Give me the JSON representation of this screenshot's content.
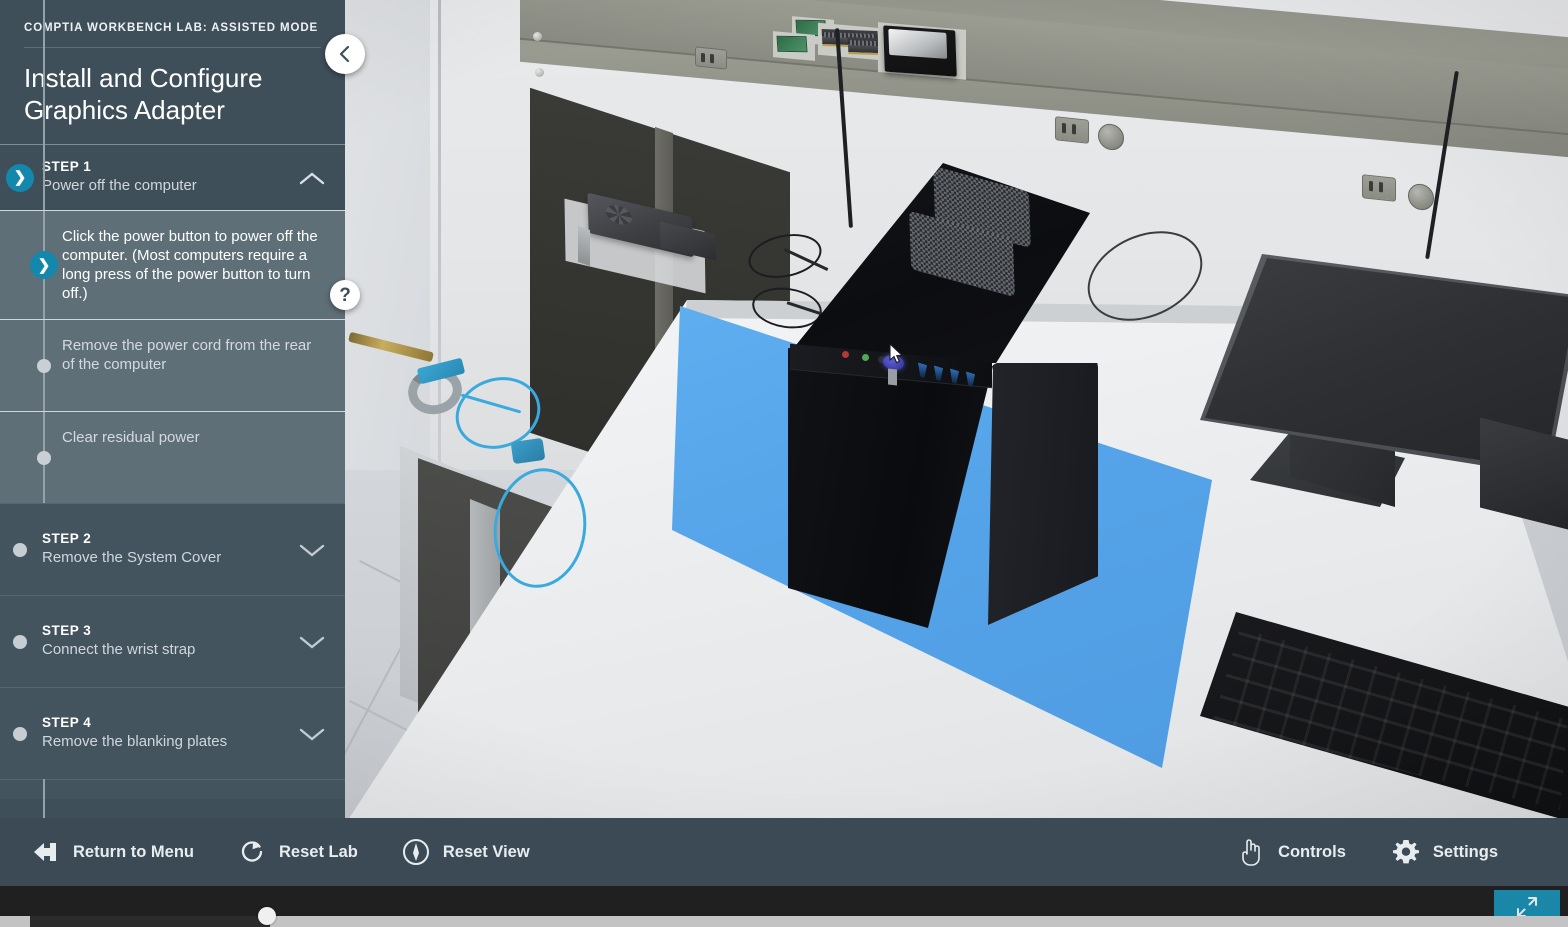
{
  "sidebar": {
    "kicker": "COMPTIA WORKBENCH LAB: ASSISTED MODE",
    "title": "Install and Configure Graphics Adapter",
    "back_icon": "chevron-left-icon",
    "help_icon": "question-mark-icon",
    "steps": [
      {
        "label": "STEP 1",
        "desc": "Power off the computer",
        "state": "active",
        "chevron": "chevron-up-icon",
        "substeps": [
          {
            "text": "Click the power button to power off the computer. (Most computers require a long press of the power button to turn off.)",
            "state": "current"
          },
          {
            "text": "Remove the power cord from the rear of the computer",
            "state": "pending"
          },
          {
            "text": "Clear residual power",
            "state": "pending"
          }
        ]
      },
      {
        "label": "STEP 2",
        "desc": "Remove the System Cover",
        "state": "idle",
        "chevron": "chevron-down-icon",
        "substeps": []
      },
      {
        "label": "STEP 3",
        "desc": "Connect the wrist strap",
        "state": "idle",
        "chevron": "chevron-down-icon",
        "substeps": []
      },
      {
        "label": "STEP 4",
        "desc": "Remove the blanking plates",
        "state": "idle",
        "chevron": "chevron-down-icon",
        "substeps": []
      }
    ]
  },
  "toolbar": {
    "left": [
      {
        "label": "Return to Menu",
        "icon": "back-arrow-icon"
      },
      {
        "label": "Reset Lab",
        "icon": "refresh-circle-icon"
      },
      {
        "label": "Reset View",
        "icon": "compass-circle-icon"
      }
    ],
    "right": [
      {
        "label": "Controls",
        "icon": "hand-pointer-icon"
      },
      {
        "label": "Settings",
        "icon": "gear-icon"
      }
    ]
  },
  "browser_chrome": {
    "fullscreen_icon": "expand-arrows-icon",
    "scrollbar": "horizontal-scrollbar"
  },
  "scene": {
    "description": "3D workbench lab with desk, PC tower, monitor, keyboard, ESD mat and wrist strap",
    "objects": [
      "pc-tower",
      "monitor",
      "keyboard",
      "graphics-adapter",
      "esd-mat",
      "esd-wrist-strap",
      "hard-drive",
      "ram-modules",
      "power-cable",
      "screwdriver"
    ],
    "cursor_icon": "mouse-cursor"
  },
  "colors": {
    "sidebar_bg": "#3e4f5a",
    "substep_bg": "#5f6f78",
    "accent": "#1487ac",
    "toolbar_bg": "#3c4a55",
    "mat_blue": "#55a3e8",
    "fullscreen_btn": "#1a87a8"
  }
}
